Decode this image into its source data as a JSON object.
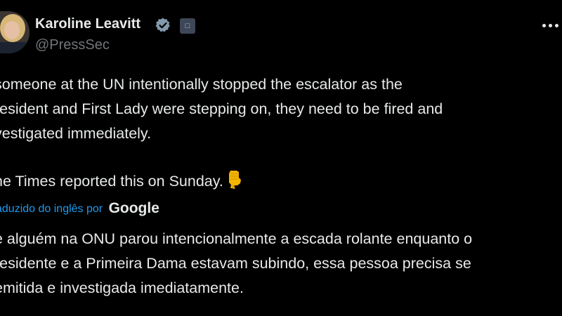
{
  "author": {
    "name": "Karoline Leavitt",
    "handle": "@PressSec",
    "verified": true,
    "avatar_icon": "avatar-photo",
    "affiliate_icon": "government-badge-icon"
  },
  "post": {
    "lines": [
      "someone at the UN intentionally stopped the escalator as the",
      "resident and First Lady were stepping on, they need to be fired and",
      "vestigated immediately."
    ],
    "second_paragraph": "he Times reported this on Sunday.",
    "emoji": "pointing-down-hand-emoji"
  },
  "translation": {
    "label": "aduzido do inglês por",
    "provider": "Google",
    "lines": [
      "e alguém na ONU parou intencionalmente a escada rolante enquanto o",
      "residente e a Primeira Dama estavam subindo, essa pessoa precisa se",
      "emitida e investigada imediatamente."
    ]
  },
  "colors": {
    "background": "#000000",
    "text": "#e7e9ea",
    "muted": "#71767b",
    "link": "#1d9bf0",
    "verified_badge": "#829aab"
  }
}
